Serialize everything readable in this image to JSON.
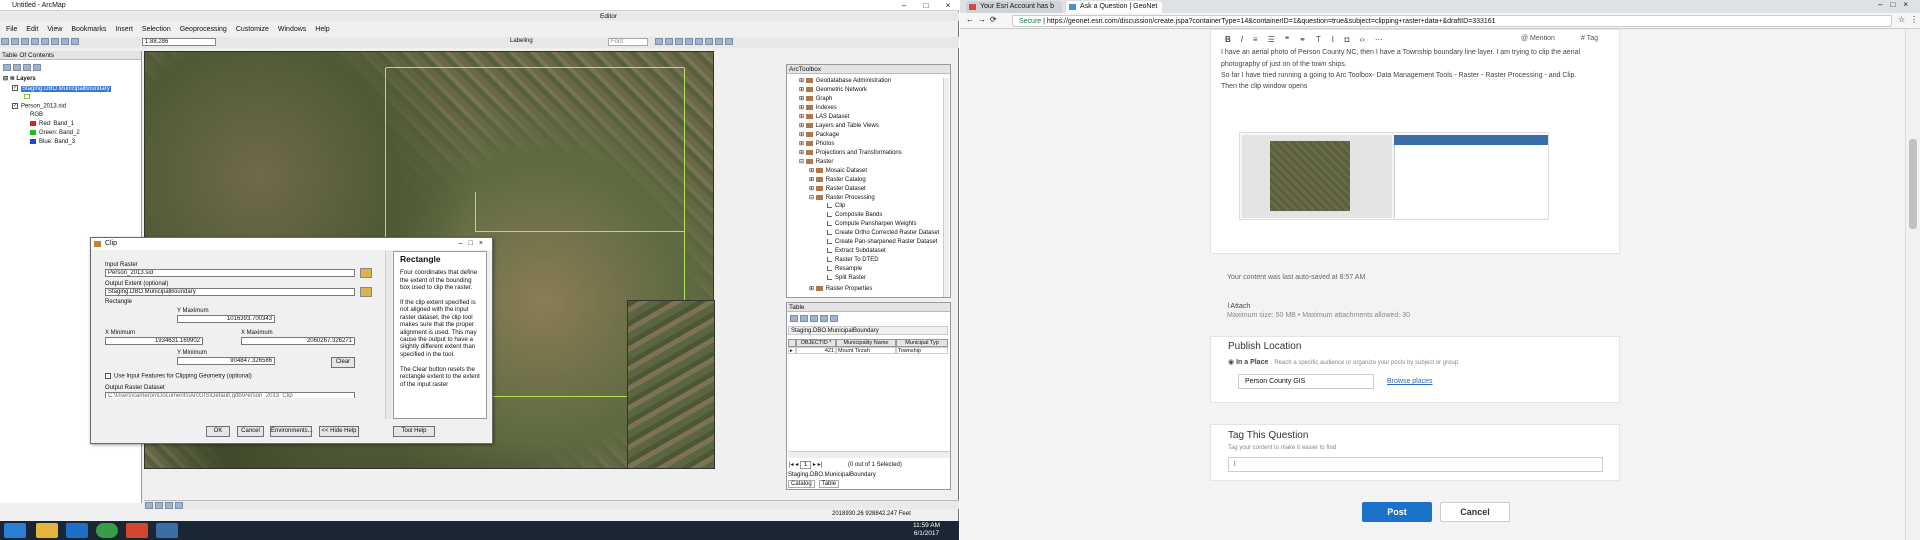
{
  "arcmap": {
    "title": "Untitled - ArcMap",
    "menu": [
      "File",
      "Edit",
      "View",
      "Bookmarks",
      "Insert",
      "Selection",
      "Geoprocessing",
      "Customize",
      "Windows",
      "Help"
    ],
    "scale": "1:88,286",
    "editor_label": "Editor",
    "labeling_label": "Labeling",
    "font_label": "Font",
    "toc": {
      "title": "Table Of Contents",
      "layers_label": "Layers",
      "layer1": "Staging.DBO.MunicipalBoundary",
      "layer2": "Person_2013.sid",
      "rgb": "RGB",
      "bands": [
        {
          "label": "Red:   Band_1",
          "color": "#e02020"
        },
        {
          "label": "Green: Band_2",
          "color": "#20c020"
        },
        {
          "label": "Blue:  Band_3",
          "color": "#2040e0"
        }
      ]
    },
    "coords": "2018930.26  928842.247 Feet"
  },
  "clip": {
    "title": "Clip",
    "input_raster_label": "Input Raster",
    "input_raster": "Person_2013.sid",
    "output_extent_label": "Output Extent (optional)",
    "output_extent": "Staging.DBO.MunicipalBoundary",
    "rectangle_label": "Rectangle",
    "ymax_label": "Y Maximum",
    "ymax": "1016393.700343",
    "xmin_label": "X Minimum",
    "xmin": "1934631.169902",
    "xmax_label": "X Maximum",
    "xmax": "2060267.326271",
    "ymin_label": "Y Minimum",
    "ymin": "904847.326586",
    "clear": "Clear",
    "use_input_label": "Use Input Features for Clipping Geometry (optional)",
    "output_label": "Output Raster Dataset",
    "output_path": "C:\\Users\\cameron\\Documents\\ArcGIS\\Default.gdb\\Person_2013_Clip",
    "buttons": {
      "ok": "OK",
      "cancel": "Cancel",
      "env": "Environments...",
      "hide": "<< Hide Help",
      "toolhelp": "Tool Help"
    },
    "help_title": "Rectangle",
    "help_p1": "Four coordinates that define the extent of the bounding box used to clip the raster.",
    "help_p2": "If the clip extent specified is not aligned with the input raster dataset, the clip tool makes sure that the proper alignment is used. This may cause the output to have a slightly different extent than specified in the tool.",
    "help_p3": "The Clear button resets the rectangle extent to the extent of the input raster"
  },
  "toolbox": {
    "title": "ArcToolbox",
    "items": [
      "Geodatabase Administration",
      "Geometric Network",
      "Graph",
      "Indexes",
      "LAS Dataset",
      "Layers and Table Views",
      "Package",
      "Photos",
      "Projections and Transformations",
      "Raster",
      "Mosaic Dataset",
      "Raster Catalog",
      "Raster Dataset",
      "Raster Processing",
      "Clip",
      "Composite Bands",
      "Compute Pansharpen Weights",
      "Create Ortho Corrected Raster Dataset",
      "Create Pan-sharpened Raster Dataset",
      "Extract Subdataset",
      "Raster To DTED",
      "Resample",
      "Split Raster",
      "Raster Properties"
    ]
  },
  "table": {
    "title": "Table",
    "tab": "Staging.DBO.MunicipalBoundary",
    "cols": [
      "OBJECTID *",
      "Municipality Name",
      "Municipal Typ"
    ],
    "row": [
      "421",
      "Mount Tirzah",
      "Township"
    ],
    "page": "1",
    "count": "(0 out of 1 Selected)",
    "bottom_label": "Staging.DBO.MunicipalBoundary",
    "tab_catalog": "Catalog",
    "tab_table": "Table"
  },
  "taskbar": {
    "time": "11:59 AM",
    "date": "6/1/2017"
  },
  "browser": {
    "tab1": "Your Esri Account has b",
    "tab2": "Ask a Question | GeoNet",
    "secure": "Secure",
    "url": "https://geonet.esri.com/discussion/create.jspa?containerType=14&containerID=1&question=true&subject=clipping+raster+data+&draftID=333161",
    "mention": "@ Mention",
    "tag_btn": "# Tag",
    "text1": "I have an aerial photo of Person County NC, then I have a Township boundary line layer. I am trying to clip the aerial",
    "text2": "photography of just on of the town ships.",
    "text3": "So far I have tried running a going to Arc Toolbox- Data Management Tools - Raster - Raster Processing - and Clip.",
    "text4": "Then the clip window opens",
    "autosaved": "Your content was last auto-saved at 8:57 AM",
    "attach": "Attach",
    "attach_info": "Maximum size: 50 MB  •  Maximum attachments allowed: 30",
    "publish_title": "Publish Location",
    "in_place": "In a Place",
    "in_place_desc": "Reach a specific audience or organize your posts by subject or group.",
    "place_value": "Person County GIS",
    "browse": "Browse places",
    "tag_title": "Tag This Question",
    "tag_desc": "Tag your content to make it easier to find",
    "post": "Post",
    "cancel": "Cancel",
    "post_color": "#1a73c9"
  }
}
